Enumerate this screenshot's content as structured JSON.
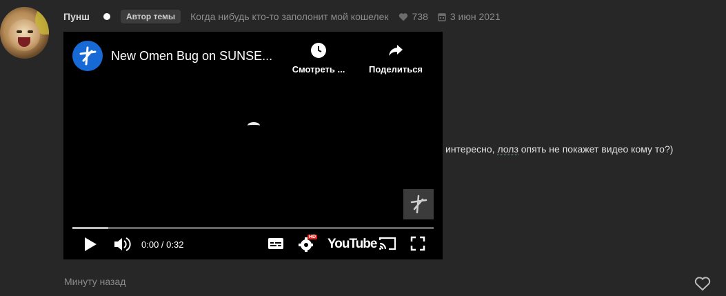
{
  "post": {
    "author": "Пунш",
    "badge": "Автор темы",
    "status": "Когда нибудь кто-то заполонит мой кошелек",
    "likes": "738",
    "date": "3 июн 2021",
    "text_before": "интересно, ",
    "text_link": "лолз",
    "text_after": " опять не покажет видео кому то?)",
    "time_ago": "Минуту назад"
  },
  "video": {
    "title": "New Omen Bug on SUNSE...",
    "watch_later": "Смотреть ...",
    "share": "Поделиться",
    "time": "0:00 / 0:32",
    "brand": "YouTube",
    "hd_badge": "HD",
    "progress": 0.1,
    "icons": [
      "channel-logo-icon",
      "clock-icon",
      "share-arrow-icon",
      "play-icon",
      "volume-icon",
      "subtitles-icon",
      "settings-icon",
      "cast-icon",
      "fullscreen-icon"
    ]
  },
  "colors": {
    "background": "#272727",
    "muted": "#8c8c8c",
    "channel_blue": "#1769d6",
    "hd_red": "#e62117"
  }
}
